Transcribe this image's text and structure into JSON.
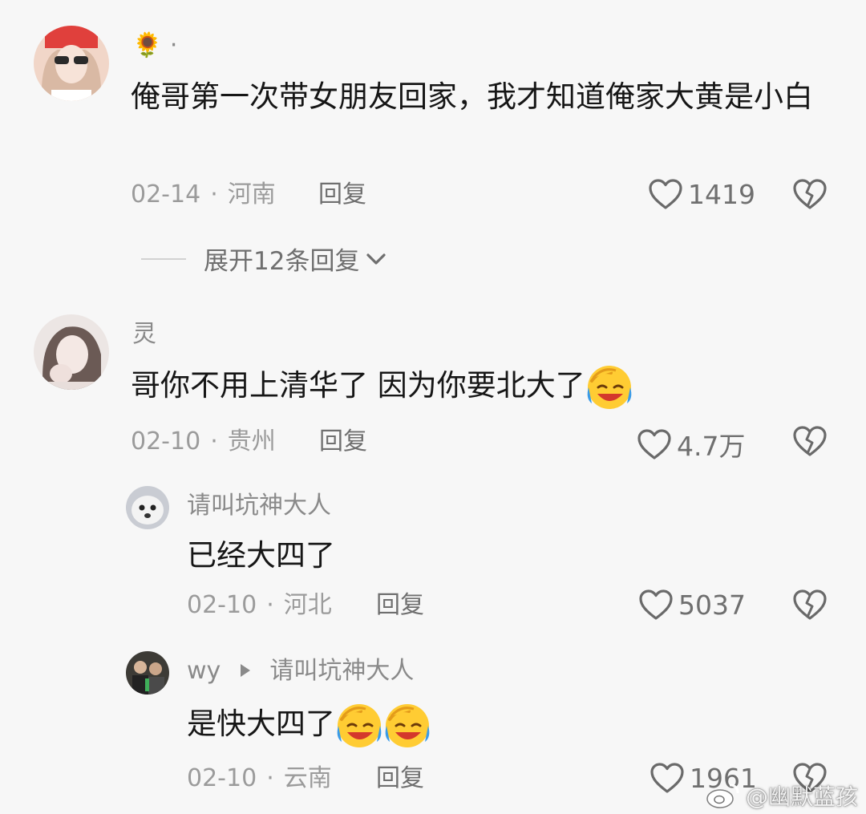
{
  "comments": [
    {
      "name": "🌻 ·",
      "text": "俺哥第一次带女朋友回家，我才知道俺家大黄是小白",
      "date": "02-14",
      "location": "河南",
      "reply_label": "回复",
      "likes": "1419",
      "expand_label": "展开12条回复"
    },
    {
      "name": "灵",
      "text": "哥你不用上清华了 因为你要北大了",
      "date": "02-10",
      "location": "贵州",
      "reply_label": "回复",
      "likes": "4.7万",
      "replies": [
        {
          "name": "请叫坑神大人",
          "text": "已经大四了",
          "date": "02-10",
          "location": "河北",
          "reply_label": "回复",
          "likes": "5037"
        },
        {
          "name": "wy",
          "reply_to": "请叫坑神大人",
          "text": "是快大四了",
          "date": "02-10",
          "location": "云南",
          "reply_label": "回复",
          "likes": "1961"
        }
      ]
    }
  ],
  "watermark": "@幽默蓝孩",
  "icons": {
    "like": "heart-outline-icon",
    "dislike": "broken-heart-icon",
    "expand": "chevron-down-icon",
    "reply_arrow": "triangle-right-icon",
    "emoji": "laughing-crying-emoji",
    "watermark_logo": "weibo-logo"
  }
}
